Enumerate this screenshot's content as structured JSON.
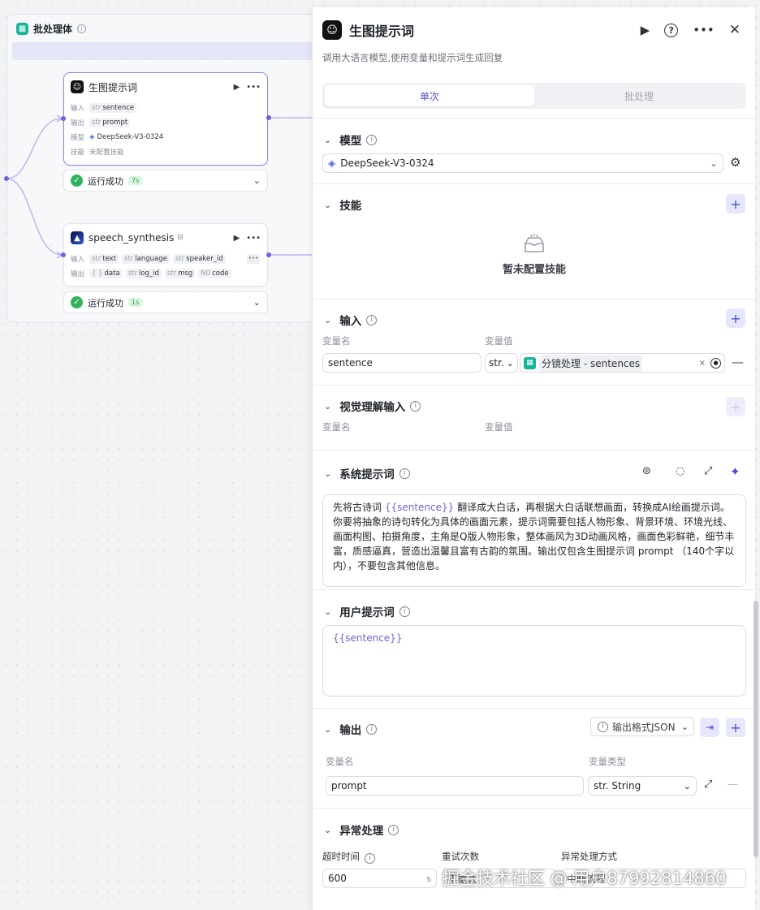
{
  "canvas": {
    "batch": {
      "title": "批处理体"
    },
    "node1": {
      "title": "生图提示词",
      "input_label": "输入",
      "input_type": "str",
      "input_name": "sentence",
      "output_label": "输出",
      "output_type": "str",
      "output_name": "prompt",
      "model_label": "模型",
      "model_value": "DeepSeek-V3-0324",
      "skill_label": "技能",
      "skill_value": "未配置技能",
      "status": "运行成功",
      "time": "7s"
    },
    "node2": {
      "title": "speech_synthesis",
      "input_label": "输入",
      "inputs": [
        {
          "type": "str",
          "name": "text"
        },
        {
          "type": "str",
          "name": "language"
        },
        {
          "type": "str",
          "name": "speaker_id"
        }
      ],
      "output_label": "输出",
      "outputs": [
        {
          "type": "{ }",
          "name": "data"
        },
        {
          "type": "str",
          "name": "log_id"
        },
        {
          "type": "str",
          "name": "msg"
        },
        {
          "type": "N0",
          "name": "code"
        }
      ],
      "status": "运行成功",
      "time": "1s"
    }
  },
  "panel": {
    "title": "生图提示词",
    "description": "调用大语言模型,使用变量和提示词生成回复",
    "tabs": [
      "单次",
      "批处理"
    ],
    "model": {
      "header": "模型",
      "value": "DeepSeek-V3-0324"
    },
    "skills": {
      "header": "技能",
      "empty": "暂未配置技能"
    },
    "inputs": {
      "header": "输入",
      "col_name": "变量名",
      "col_value": "变量值",
      "row": {
        "name": "sentence",
        "type": "str.",
        "ref_source": "分镜处理",
        "ref_sep": " - ",
        "ref_field": "sentences"
      }
    },
    "vision": {
      "header": "视觉理解输入",
      "col_name": "变量名",
      "col_value": "变量值"
    },
    "system_prompt": {
      "header": "系统提示词",
      "before": "先将古诗词 ",
      "var": "{{sentence}}",
      "after": " 翻译成大白话，再根据大白话联想画面，转换成AI绘画提示词。你要将抽象的诗句转化为具体的画面元素，提示词需要包括人物形象、背景环境、环境光线、画面构图、拍摄角度，主角是Q版人物形象，整体画风为3D动画风格，画面色彩鲜艳，细节丰富，质感逼真，营造出温馨且富有古韵的氛围。输出仅包含生图提示词 prompt （140个字以内），不要包含其他信息。"
    },
    "user_prompt": {
      "header": "用户提示词",
      "value": "{{sentence}}"
    },
    "output": {
      "header": "输出",
      "format": "输出格式JSON",
      "col_name": "变量名",
      "col_type": "变量类型",
      "row": {
        "name": "prompt",
        "type": "str. String"
      }
    },
    "exception": {
      "header": "异常处理",
      "timeout_label": "超时时间",
      "timeout_value": "600",
      "timeout_unit": "s",
      "retry_label": "重试次数",
      "retry_value": "不重试",
      "mode_label": "异常处理方式",
      "mode_value": "中断流程"
    }
  },
  "watermark": "掘金技术社区 @ 用户87992814860",
  "colors": {
    "accent": "#4b4cd1",
    "success": "#2fb25a",
    "edge": "#6d63e0"
  }
}
